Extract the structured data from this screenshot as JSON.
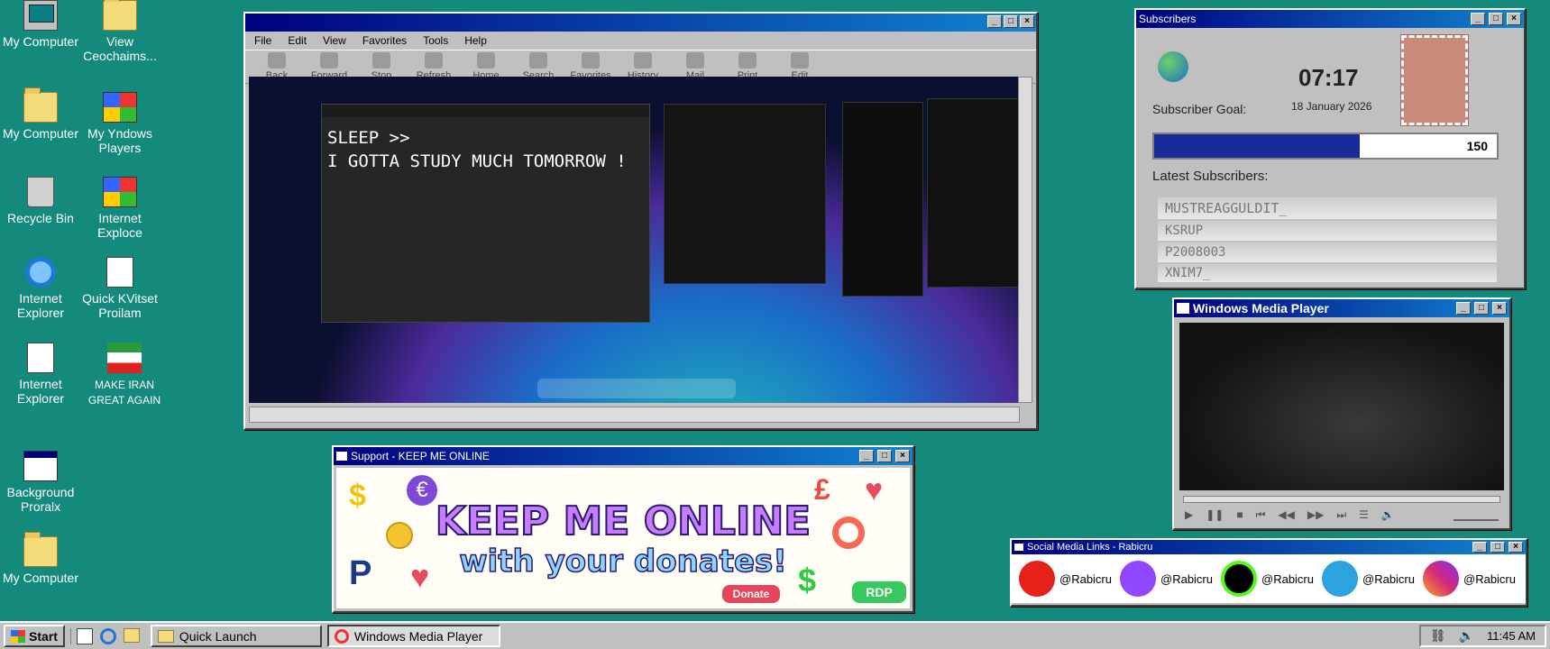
{
  "desktop_icons": [
    {
      "label": "My Computer"
    },
    {
      "label": "View Ceochaims..."
    },
    {
      "label": "My Computer"
    },
    {
      "label": "My Yndows Players"
    },
    {
      "label": "Recycle Bin"
    },
    {
      "label": "Internet Exploce"
    },
    {
      "label": "Internet Explorer"
    },
    {
      "label": "Quick KVitset Proilam"
    },
    {
      "label": "Internet Explorer"
    },
    {
      "label": "MAKE IRAN GREAT AGAIN"
    },
    {
      "label": "Background Proralx"
    },
    {
      "label": "My Computer"
    }
  ],
  "browser": {
    "menu": [
      "File",
      "Edit",
      "View",
      "Favorites",
      "Tools",
      "Help"
    ],
    "toolbar": [
      "Back",
      "Forward",
      "Stop",
      "Refresh",
      "Home",
      "Search",
      "Favorites",
      "History",
      "Mail",
      "Print",
      "Edit"
    ],
    "note_line1": "SLEEP >>",
    "note_line2": "I GOTTA STUDY MUCH TOMORROW !"
  },
  "subscribers": {
    "title": "Subscribers",
    "time": "07:17",
    "date": "18 January 2026",
    "goal_label": "Subscriber Goal:",
    "goal_value": "150",
    "goal_progress": 0.6,
    "latest_label": "Latest Subscribers:",
    "latest": [
      "MUSTREAGGULDIT_",
      "KSRUP",
      "P2008003",
      "XNIM7_"
    ]
  },
  "media_player": {
    "title": "Windows Media Player"
  },
  "support": {
    "title": "Support - KEEP ME ONLINE",
    "headline": "KEEP ME ONLINE",
    "subline": "with your donates!",
    "donate_label": "Donate",
    "rdp_label": "RDP"
  },
  "social": {
    "title": "Social Media Links - Rabicru",
    "links": [
      "@Rabicru",
      "@Rabicru",
      "@Rabicru",
      "@Rabicru",
      "@Rabicru"
    ],
    "icons": [
      "youtube-icon",
      "twitch-icon",
      "kick-icon",
      "telegram-icon",
      "instagram-icon"
    ],
    "colors": [
      "#e62117",
      "#9146ff",
      "#53fc18",
      "#2aa3de",
      "#d62976"
    ]
  },
  "taskbar": {
    "start_label": "Start",
    "quick_launch_label": "Quick Launch",
    "active_window_label": "Windows Media Player",
    "clock": "11:45 AM"
  }
}
